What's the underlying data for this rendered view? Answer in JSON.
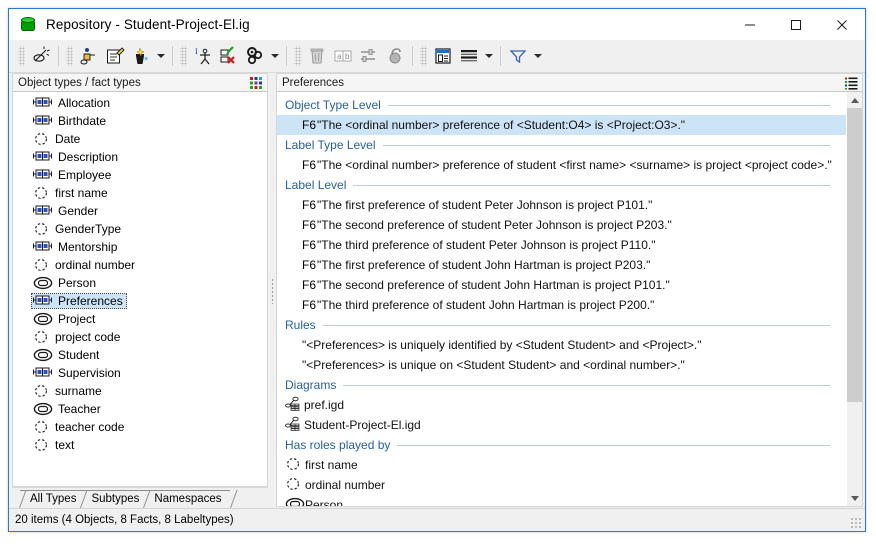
{
  "window": {
    "title": "Repository - Student-Project-El.ig",
    "icon": "repository-cylinder-icon",
    "minimize_label": "—",
    "maximize_label": "□",
    "close_label": "✕"
  },
  "toolbar": {
    "groups": [
      {
        "buttons": [
          {
            "name": "verbalize-model-icon"
          }
        ]
      },
      {
        "buttons": [
          {
            "name": "object-type-icon"
          },
          {
            "name": "edit-notes-icon"
          },
          {
            "name": "new-wizard-icon"
          }
        ],
        "dropdown": true
      },
      {
        "buttons": [
          {
            "name": "generate-icon"
          },
          {
            "name": "validate-checklist-icon"
          },
          {
            "name": "settings-gears-icon"
          }
        ],
        "dropdown": true
      },
      {
        "buttons": [
          {
            "name": "delete-trash-icon"
          },
          {
            "name": "rename-ab-icon"
          },
          {
            "name": "properties-icon"
          },
          {
            "name": "lock-icon"
          }
        ]
      },
      {
        "buttons": [
          {
            "name": "window-view-icon"
          }
        ]
      },
      {
        "buttons": [
          {
            "name": "list-view-icon"
          }
        ],
        "dropdown": true
      },
      {
        "buttons": [
          {
            "name": "filter-funnel-icon"
          }
        ],
        "dropdown": true
      }
    ]
  },
  "left_pane": {
    "header": "Object types / fact types",
    "header_button": "grid-view-icon",
    "items": [
      {
        "label": "Allocation",
        "kind": "fact"
      },
      {
        "label": "Birthdate",
        "kind": "fact"
      },
      {
        "label": "Date",
        "kind": "label"
      },
      {
        "label": "Description",
        "kind": "fact"
      },
      {
        "label": "Employee",
        "kind": "fact"
      },
      {
        "label": "first name",
        "kind": "label"
      },
      {
        "label": "Gender",
        "kind": "fact"
      },
      {
        "label": "GenderType",
        "kind": "label"
      },
      {
        "label": "Mentorship",
        "kind": "fact"
      },
      {
        "label": "ordinal number",
        "kind": "label"
      },
      {
        "label": "Person",
        "kind": "object"
      },
      {
        "label": "Preferences",
        "kind": "fact",
        "selected": true
      },
      {
        "label": "Project",
        "kind": "object"
      },
      {
        "label": "project code",
        "kind": "label"
      },
      {
        "label": "Student",
        "kind": "object"
      },
      {
        "label": "Supervision",
        "kind": "fact"
      },
      {
        "label": "surname",
        "kind": "label"
      },
      {
        "label": "Teacher",
        "kind": "object"
      },
      {
        "label": "teacher code",
        "kind": "label"
      },
      {
        "label": "text",
        "kind": "label"
      }
    ],
    "tabs": [
      {
        "label": "All Types",
        "active": true
      },
      {
        "label": "Subtypes",
        "active": false
      },
      {
        "label": "Namespaces",
        "active": false
      }
    ]
  },
  "right_pane": {
    "header": "Preferences",
    "header_button": "list-settings-icon",
    "sections": [
      {
        "title": "Object Type Level",
        "entries": [
          {
            "code": "F6",
            "text": "\"The <ordinal number> preference of <Student:O4> is <Project:O3>.\"",
            "selected": true
          }
        ]
      },
      {
        "title": "Label Type Level",
        "entries": [
          {
            "code": "F6",
            "text": "\"The <ordinal number> preference of student <first name> <surname> is project <project code>.\""
          }
        ]
      },
      {
        "title": "Label Level",
        "entries": [
          {
            "code": "F6",
            "text": "\"The first preference of student Peter Johnson is project P101.\""
          },
          {
            "code": "F6",
            "text": "\"The second preference of student Peter Johnson is project P203.\""
          },
          {
            "code": "F6",
            "text": "\"The third preference of student Peter Johnson is project P110.\""
          },
          {
            "code": "F6",
            "text": "\"The first preference of student John Hartman is project P203.\""
          },
          {
            "code": "F6",
            "text": "\"The second preference of student John Hartman is project P101.\""
          },
          {
            "code": "F6",
            "text": "\"The third preference of student John Hartman is project P200.\""
          }
        ]
      },
      {
        "title": "Rules",
        "rules": [
          "\"<Preferences> is uniquely identified by <Student Student> and <Project>.\"",
          "\"<Preferences> is unique on <Student Student> and <ordinal number>.\""
        ]
      },
      {
        "title": "Diagrams",
        "diagrams": [
          {
            "label": "pref.igd",
            "icon": "diagram-icon"
          },
          {
            "label": "Student-Project-El.igd",
            "icon": "diagram-icon"
          }
        ]
      },
      {
        "title": "Has roles played by",
        "roles": [
          {
            "label": "first name",
            "kind": "label"
          },
          {
            "label": "ordinal number",
            "kind": "label"
          },
          {
            "label": "Person",
            "kind": "object"
          }
        ]
      }
    ],
    "scrollbar": {
      "thumb_percent": 77
    }
  },
  "statusbar": {
    "text": "20 items (4 Objects, 8 Facts, 8 Labeltypes)"
  },
  "colors": {
    "accent_border": "#2a7cc7",
    "section_heading": "#2660a4",
    "selection": "#cde4f7",
    "chrome": "#f0f0f0"
  }
}
